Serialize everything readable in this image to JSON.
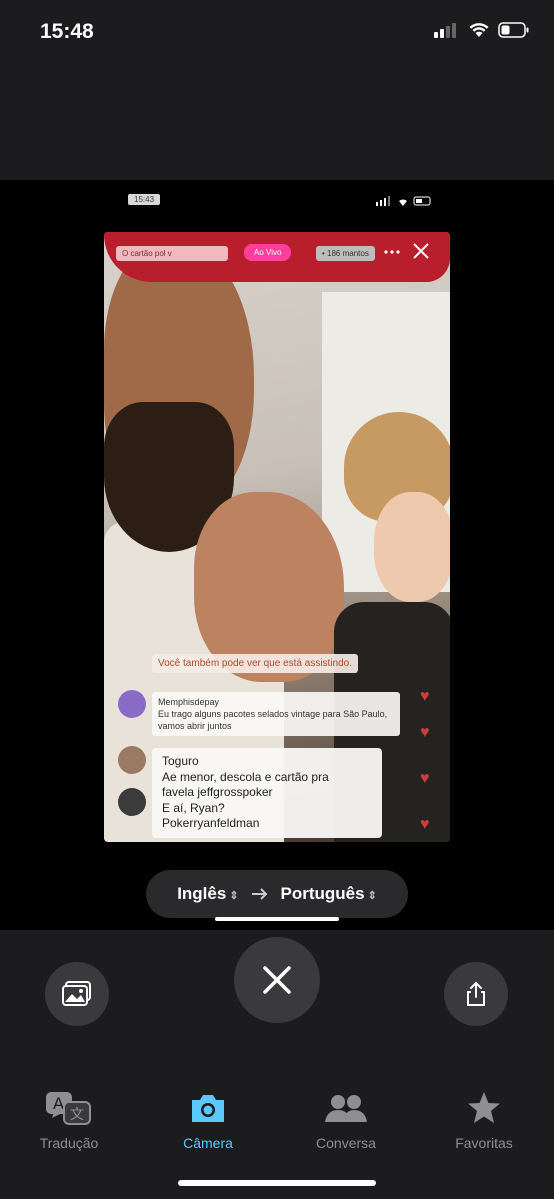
{
  "status_bar": {
    "time": "15:48"
  },
  "screenshot": {
    "inner_time": "15:43",
    "live_tags": {
      "left": "O cartão pol v",
      "live": "Ao Vivo",
      "viewers": "• 186 mantos"
    },
    "chat_note": "Você também pode ver que está assistindo.",
    "message1": {
      "user": "Memphisdepay",
      "text": "Eu trago alguns pacotes selados vintage para São Paulo, vamos abrir juntos"
    },
    "message2": {
      "line1": "Toguro",
      "line2": "Ae menor, descola e cartão pra",
      "line3": "favela jeffgrosspoker",
      "line4": "E aí, Ryan?",
      "line5": "Pokerryanfeldman"
    }
  },
  "language_selector": {
    "source": "Inglês",
    "target": "Português"
  },
  "tabs": [
    {
      "label": "Tradução",
      "icon": "translate-icon",
      "active": false
    },
    {
      "label": "Câmera",
      "icon": "camera-icon",
      "active": true
    },
    {
      "label": "Conversa",
      "icon": "people-icon",
      "active": false
    },
    {
      "label": "Favoritas",
      "icon": "star-icon",
      "active": false
    }
  ],
  "colors": {
    "accent": "#5ac8fa",
    "background": "#1c1c1e",
    "button": "#3a3a3c"
  }
}
